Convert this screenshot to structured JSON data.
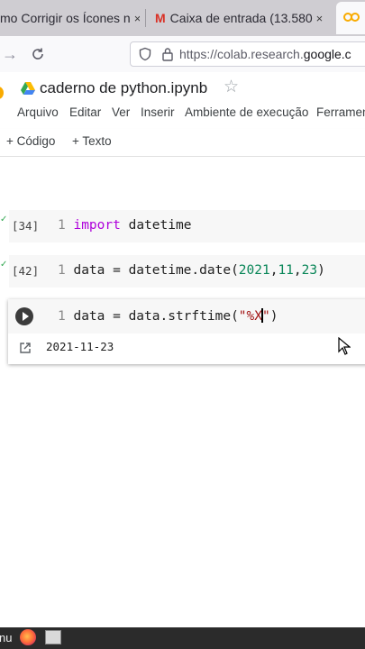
{
  "browser": {
    "tabs": [
      {
        "title": "mo Corrigir os Ícones n",
        "close": "×"
      },
      {
        "title": "Caixa de entrada (13.580",
        "close": "×"
      }
    ],
    "active_tab_logo": "colab-logo",
    "url_prefix": "https://colab.research.",
    "url_domain": "google.c",
    "nav_icons": [
      "forward-icon",
      "reload-icon",
      "shield-icon",
      "lock-icon"
    ]
  },
  "notebook": {
    "title": "caderno de python.ipynb",
    "star": "☆",
    "menu": [
      "Arquivo",
      "Editar",
      "Ver",
      "Inserir",
      "Ambiente de execução",
      "Ferramen"
    ],
    "toolbar": {
      "add_code": "+ Código",
      "add_text": "+ Texto"
    }
  },
  "cells": [
    {
      "exec_count": "[34]",
      "line_no": "1",
      "kw": "import",
      "rest": " datetime"
    },
    {
      "exec_count": "[42]",
      "line_no": "1",
      "pre": "data = datetime.date(",
      "n1": "2021",
      "c1": ",",
      "n2": "11",
      "c2": ",",
      "n3": "23",
      "post": ")"
    }
  ],
  "active_cell": {
    "line_no": "1",
    "pre": "data = data.strftime(",
    "str_open": "\"%X",
    "str_close": "\"",
    "post": ")",
    "output": "2021-11-23"
  },
  "taskbar": {
    "label": "nu"
  },
  "colors": {
    "accent_green": "#34a853",
    "keyword": "#af00db",
    "number": "#098658",
    "string": "#a31515",
    "colab_orange": "#f9ab00"
  }
}
